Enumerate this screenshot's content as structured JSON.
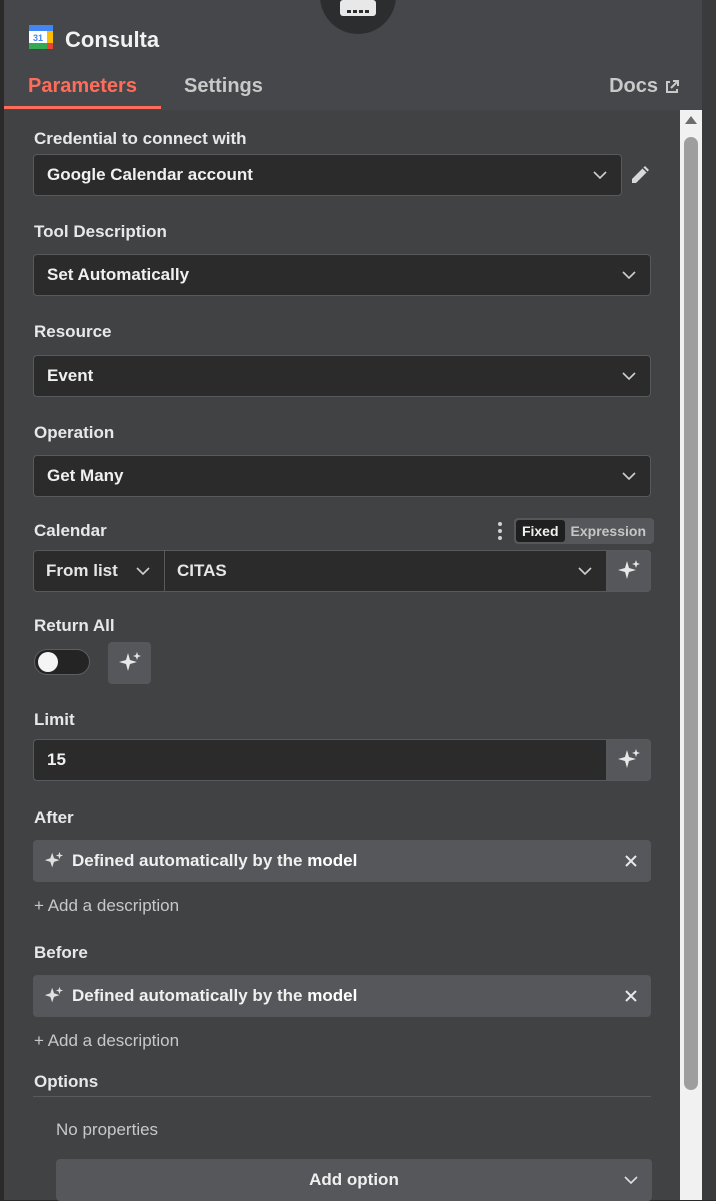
{
  "header": {
    "title": "Consulta",
    "tabs": [
      {
        "label": "Parameters",
        "active": true
      },
      {
        "label": "Settings",
        "active": false
      }
    ],
    "docs_label": "Docs",
    "accent": "#ff6d5a"
  },
  "fields": {
    "credential": {
      "label": "Credential to connect with",
      "value": "Google Calendar account"
    },
    "tool_description": {
      "label": "Tool Description",
      "value": "Set Automatically"
    },
    "resource": {
      "label": "Resource",
      "value": "Event"
    },
    "operation": {
      "label": "Operation",
      "value": "Get Many"
    },
    "calendar": {
      "label": "Calendar",
      "mode": "From list",
      "value": "CITAS",
      "toggle": {
        "fixed": "Fixed",
        "expression": "Expression",
        "selected": "Fixed"
      }
    },
    "return_all": {
      "label": "Return All",
      "on": false
    },
    "limit": {
      "label": "Limit",
      "value": "15"
    },
    "after": {
      "label": "After",
      "auto_prefix": "Defined automatically by the",
      "auto_bold": "model",
      "add_desc": "+ Add a description"
    },
    "before": {
      "label": "Before",
      "auto_prefix": "Defined automatically by the",
      "auto_bold": "model",
      "add_desc": "+ Add a description"
    }
  },
  "options": {
    "label": "Options",
    "empty_text": "No properties",
    "add_button": "Add option"
  },
  "icons": [
    "google-calendar-icon",
    "robot-icon",
    "external-link-icon",
    "pencil-icon",
    "chevron-down-icon",
    "sparkle-icon",
    "more-vertical-icon",
    "close-icon",
    "scroll-up-icon"
  ]
}
